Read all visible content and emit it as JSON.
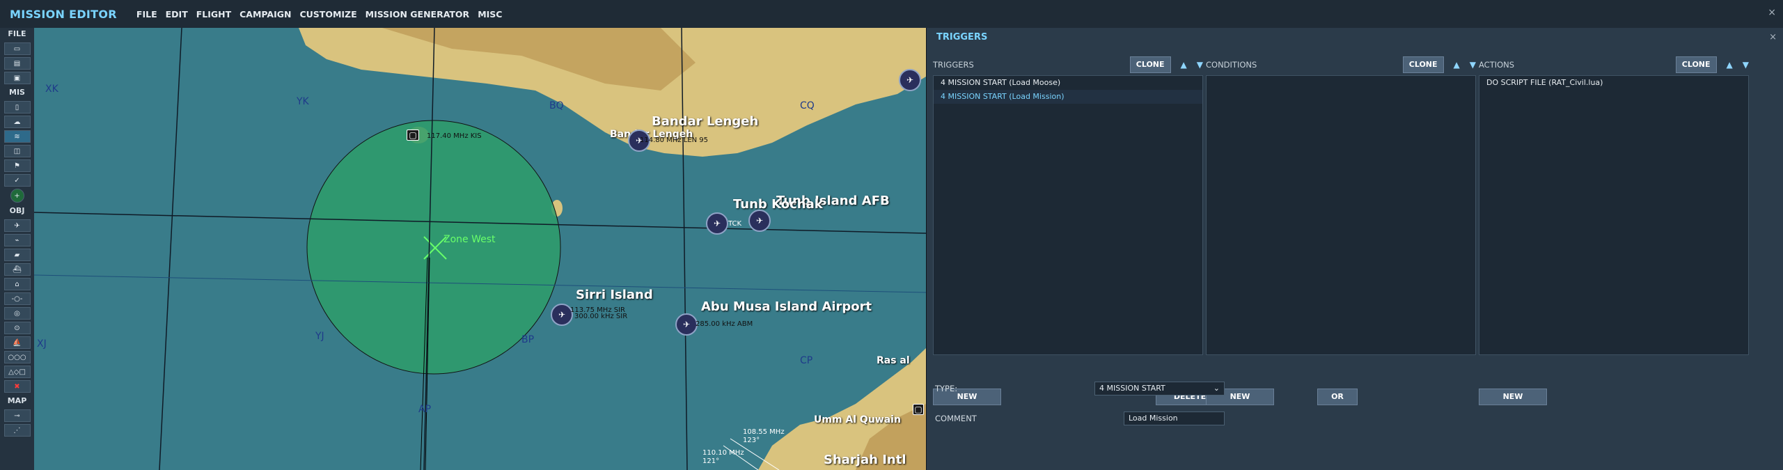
{
  "app": {
    "title": "MISSION EDITOR",
    "close_glyph": "×"
  },
  "menu": [
    "FILE",
    "EDIT",
    "FLIGHT",
    "CAMPAIGN",
    "CUSTOMIZE",
    "MISSION GENERATOR",
    "MISC"
  ],
  "toolbar": {
    "sections": {
      "file": "FILE",
      "mis": "MIS",
      "obj": "OBJ",
      "map": "MAP"
    }
  },
  "map": {
    "grid_labels": [
      "XK",
      "YK",
      "BQ",
      "CQ",
      "XJ",
      "YJ",
      "BP",
      "CP",
      "AP"
    ],
    "places": {
      "bandar_lengeh": "Bandar Lengeh",
      "bandar_lengeh_small": "Bandar Lengeh",
      "tunb_island": "Tunb Island AFB",
      "tunb_kochak": "Tunb Kochak",
      "sirri_island": "Sirri Island",
      "abu_musa": "Abu Musa Island Airport",
      "umm_al_quwain": "Umm Al Quwain",
      "sharjah": "Sharjah Intl",
      "ras_al": "Ras al"
    },
    "freqs": {
      "kis": "117.40 MHz KIS",
      "lenghe": "114.80 MHz LEN 95",
      "tnk": "TCK",
      "sir": "113.75 MHz SIR",
      "sir2": "300.00 kHz SIR",
      "abm": "285.00 kHz ABM",
      "shj1": "108.55 MHz",
      "shj1b": "123°",
      "shj2": "110.10 MHz",
      "shj2b": "121°"
    },
    "zone": {
      "label": "Zone West",
      "color": "#2e9e6a"
    }
  },
  "triggers_panel": {
    "title": "TRIGGERS",
    "close_glyph": "×",
    "triggers": {
      "label": "TRIGGERS",
      "clone": "CLONE",
      "items": [
        "4 MISSION START (Load Moose)",
        "4 MISSION START (Load Mission)"
      ],
      "selected_index": 1,
      "new": "NEW",
      "delete": "DELETE"
    },
    "conditions": {
      "label": "CONDITIONS",
      "clone": "CLONE",
      "new": "NEW",
      "or": "OR"
    },
    "actions": {
      "label": "ACTIONS",
      "clone": "CLONE",
      "items": [
        "DO SCRIPT FILE (RAT_Civil.lua)"
      ],
      "new": "NEW"
    },
    "type": {
      "label": "TYPE:",
      "value": "4 MISSION START"
    },
    "comment": {
      "label": "COMMENT",
      "value": "Load Mission"
    }
  },
  "colors": {
    "accent": "#7ad4ff",
    "sea": "#397c8a",
    "zone": "#2e9e6a",
    "panel": "#2b3b4a"
  }
}
